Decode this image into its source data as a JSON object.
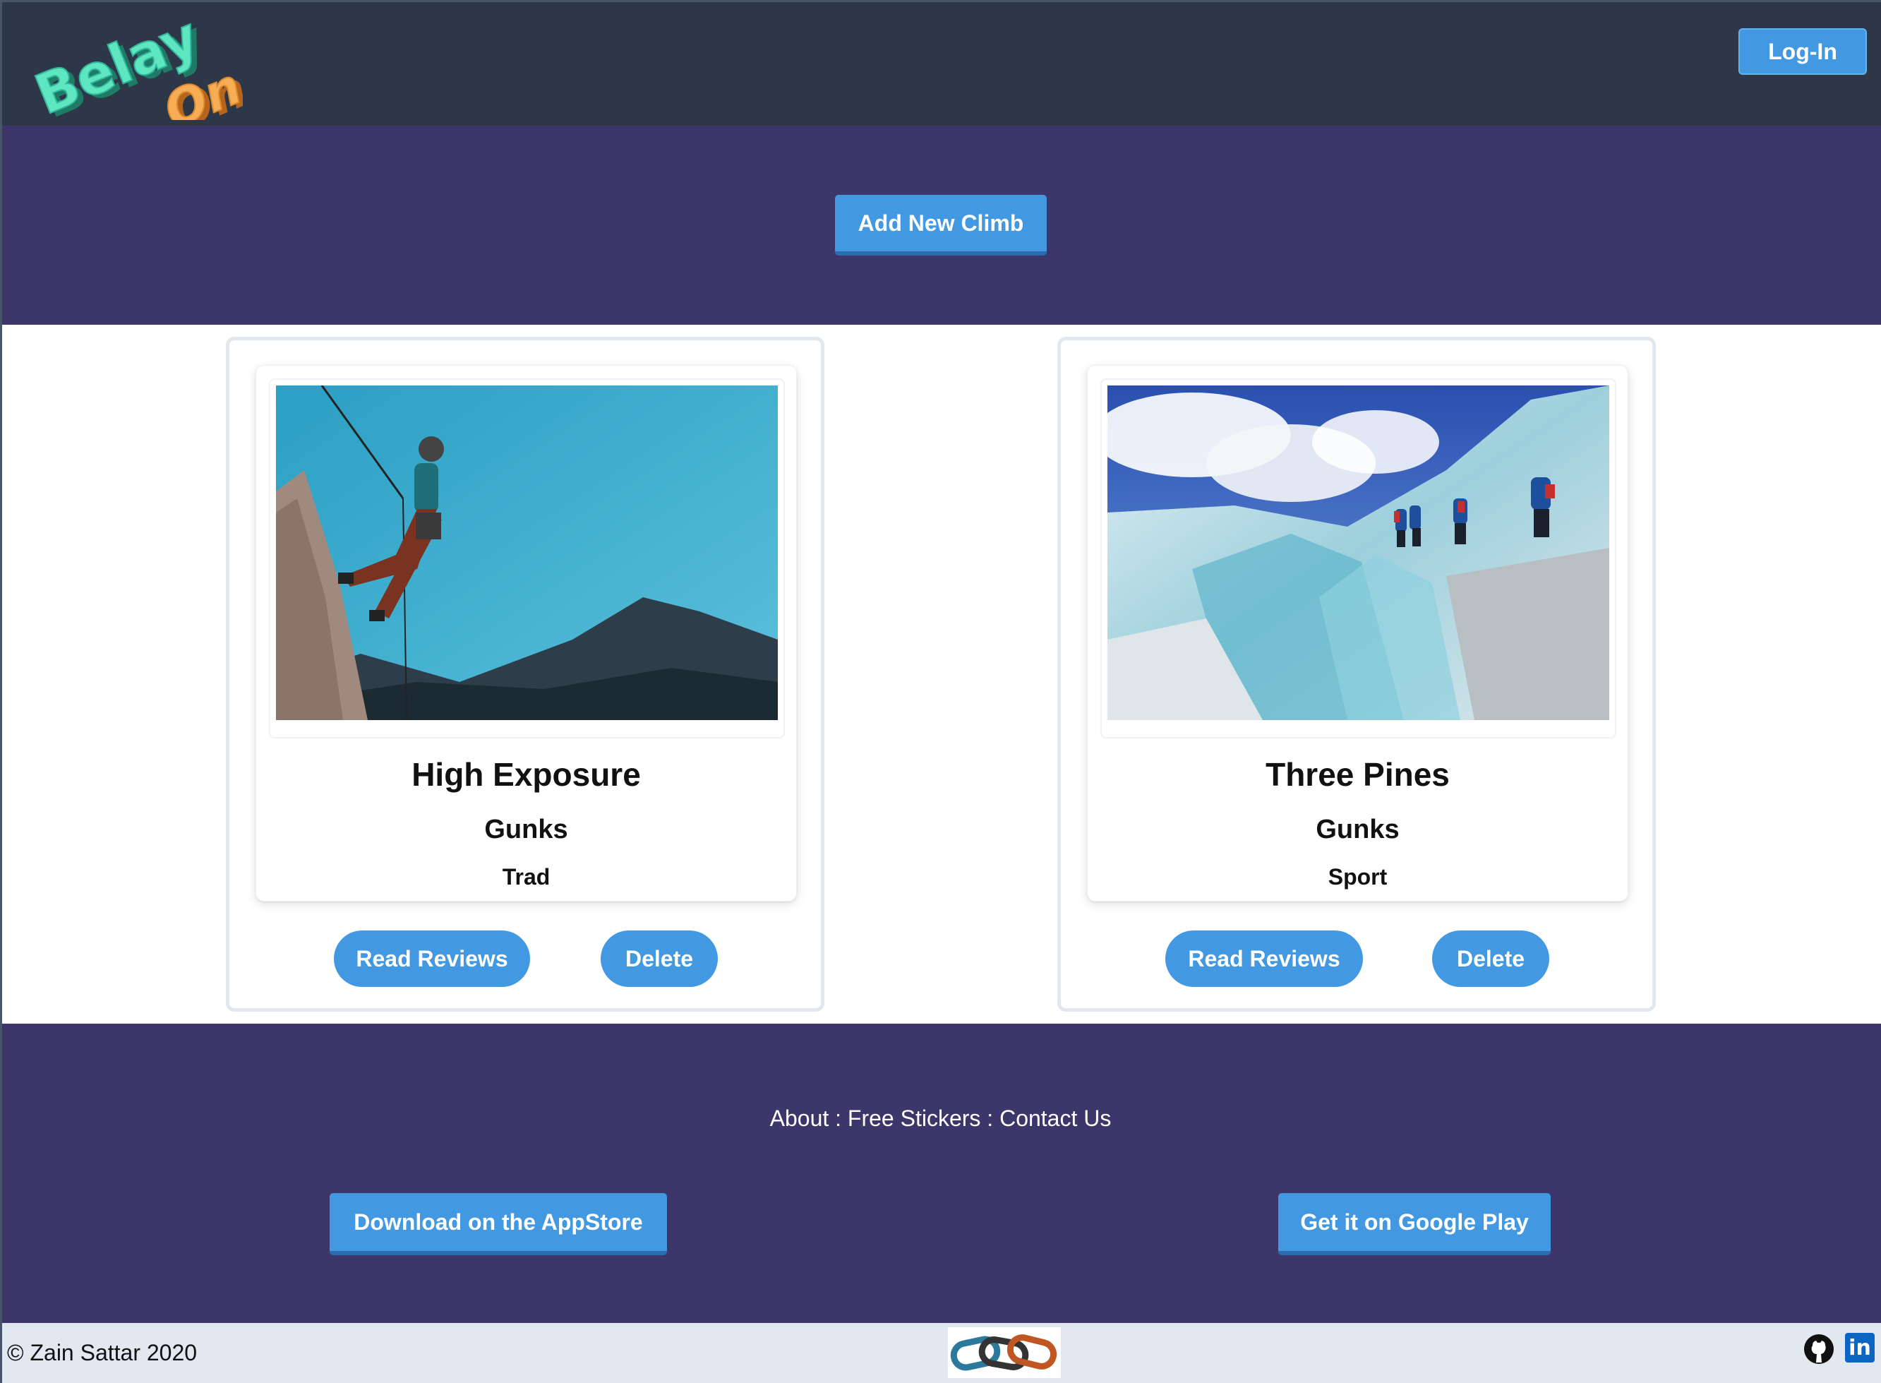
{
  "header": {
    "logo_text": "BelayOn",
    "login_label": "Log-In"
  },
  "hero": {
    "add_label": "Add New Climb"
  },
  "climbs": [
    {
      "name": "High Exposure",
      "area": "Gunks",
      "type": "Trad",
      "reviews_label": "Read Reviews",
      "delete_label": "Delete",
      "image": "climber-rappelling-photo"
    },
    {
      "name": "Three Pines",
      "area": "Gunks",
      "type": "Sport",
      "reviews_label": "Read Reviews",
      "delete_label": "Delete",
      "image": "glacier-hikers-photo"
    }
  ],
  "footer": {
    "links": [
      "About",
      "Free Stickers",
      "Contact Us"
    ],
    "separator": " : ",
    "appstore_label": "Download on the AppStore",
    "googleplay_label": "Get it on Google Play"
  },
  "bottom": {
    "copyright": "© Zain Sattar 2020",
    "linkedin_label": "in"
  },
  "colors": {
    "header_bg": "#2d3748",
    "band_bg": "#3c366b",
    "accent": "#4299e1",
    "bottom_bg": "#e2e8f0"
  }
}
